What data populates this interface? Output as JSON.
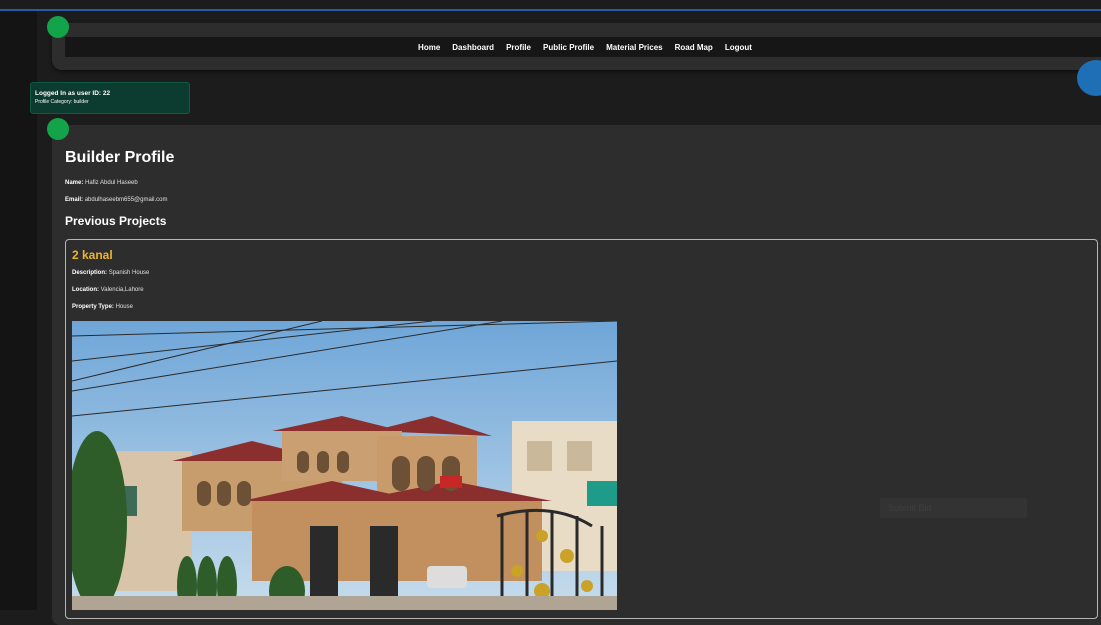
{
  "nav": {
    "items": [
      "Home",
      "Dashboard",
      "Profile",
      "Public Profile",
      "Material Prices",
      "Road Map",
      "Logout"
    ]
  },
  "session": {
    "logged_in": "Logged In as user ID: 22",
    "category": "Profile Category: builder"
  },
  "profile": {
    "title": "Builder Profile",
    "name_label": "Name:",
    "name": "Hafiz Abdul Haseeb",
    "email_label": "Email:",
    "email": "abdulhaseebm655@gmail.com"
  },
  "projects": {
    "section_title": "Previous Projects",
    "items": [
      {
        "title": "2 kanal",
        "description_label": "Description:",
        "description": "Spanish House",
        "location_label": "Location:",
        "location": "Valencia,Lahore",
        "type_label": "Property Type:",
        "type": "House"
      }
    ]
  },
  "ghost_button": {
    "label": "Submit Bid"
  },
  "colors": {
    "accent": "#13a348",
    "nav_blue": "#1f6fb6",
    "project_title": "#f0b429"
  }
}
